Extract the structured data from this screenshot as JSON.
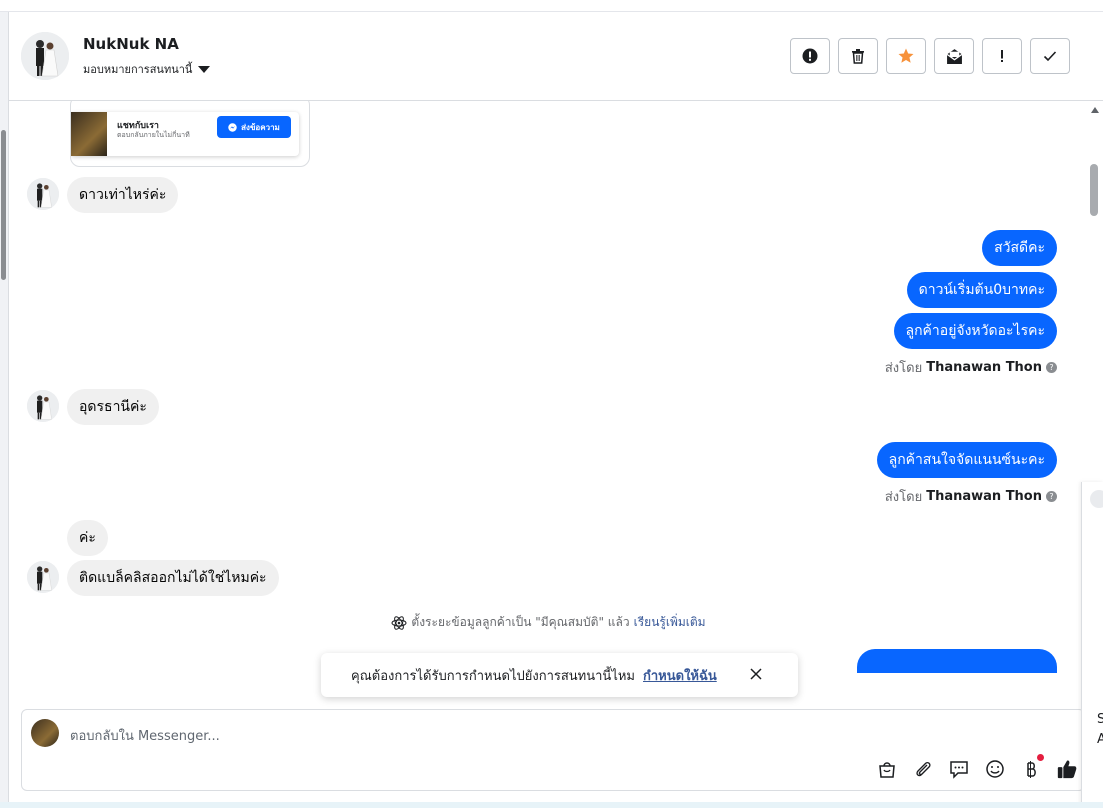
{
  "header": {
    "contact_name": "NukNuk NA",
    "assign_label": "มอบหมายการสนทนานี้",
    "actions": [
      {
        "icon": "alert-circle-icon",
        "name": "report-spam-button"
      },
      {
        "icon": "trash-icon",
        "name": "delete-button"
      },
      {
        "icon": "star-icon",
        "name": "star-button"
      },
      {
        "icon": "mail-open-icon",
        "name": "mark-unread-button"
      },
      {
        "icon": "exclamation-icon",
        "name": "follow-up-button"
      },
      {
        "icon": "check-icon",
        "name": "mark-done-button"
      }
    ],
    "star_color": "#f7923b"
  },
  "preview": {
    "title": "แชทกับเรา",
    "subtitle": "ตอบกลับภายในไม่กี่นาที",
    "button_label": "ส่งข้อความ"
  },
  "messages": [
    {
      "side": "in",
      "text": "ดาวเท่าไหร่ค่ะ"
    },
    {
      "side": "out",
      "text": "สวัสดีคะ"
    },
    {
      "side": "out",
      "text": "ดาวน์เริ่มต้น0บาทคะ"
    },
    {
      "side": "out",
      "text": "ลูกค้าอยู่จังหวัดอะไรคะ"
    },
    {
      "side": "in",
      "text": "อุดรธานีค่ะ"
    },
    {
      "side": "out",
      "text": "ลูกค้าสนใจจัดแนนซ์นะคะ"
    },
    {
      "side": "in",
      "text": "ค่ะ"
    },
    {
      "side": "in",
      "text": "ติดแบล็คลิสออกไม่ได้ใช่ไหมค่ะ"
    }
  ],
  "sent_by": {
    "prefix": "ส่งโดย",
    "agent": "Thanawan Thon",
    "help": "?"
  },
  "system_note": {
    "text": "ตั้งระยะข้อมูลลูกค้าเป็น \"มีคุณสมบัติ\" แล้ว",
    "link": "เรียนรู้เพิ่มเติม"
  },
  "toast": {
    "text": "คุณต้องการได้รับการกำหนดไปยังการสนทนานี้ไหม",
    "link": "กำหนดให้ฉัน"
  },
  "composer": {
    "placeholder": "ตอบกลับใน Messenger..."
  },
  "right_panel": {
    "line1": "S",
    "line2": "A"
  },
  "colors": {
    "brand_blue": "#0866ff",
    "incoming_bubble": "#f0f0f0",
    "notification_dot": "#e41e3f"
  }
}
